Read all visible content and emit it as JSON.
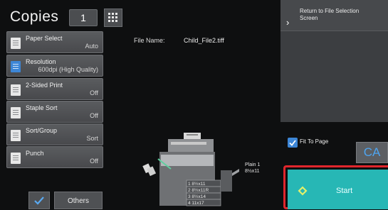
{
  "header": {
    "copies_label": "Copies",
    "copies_count": "1"
  },
  "settings": [
    {
      "title": "Paper Select",
      "value": "Auto",
      "icon": "paper-icon"
    },
    {
      "title": "Resolution",
      "value": "600dpi (High Quality)",
      "icon": "resolution-icon"
    },
    {
      "title": "2-Sided Print",
      "value": "Off",
      "icon": "two-sided-icon"
    },
    {
      "title": "Staple Sort",
      "value": "Off",
      "icon": "staple-icon"
    },
    {
      "title": "Sort/Group",
      "value": "Sort",
      "icon": "sort-group-icon"
    },
    {
      "title": "Punch",
      "value": "Off",
      "icon": "punch-icon"
    }
  ],
  "bottom": {
    "others_label": "Others"
  },
  "file": {
    "label": "File Name:",
    "value": "Child_File2.tiff"
  },
  "right": {
    "return_label": "Return to File Selection Screen",
    "fit_label": "Fit To Page",
    "fit_checked": true,
    "ca_label": "CA",
    "start_label": "Start"
  },
  "machine": {
    "paper_line1": "Plain 1",
    "paper_line2": "8½x11",
    "trays": [
      "1  8½x11",
      "2  8½x11R",
      "3  8½x14",
      "4  11x17"
    ]
  },
  "colors": {
    "start": "#27b7b5",
    "start_outline": "#e0262c",
    "accent": "#3d86d6"
  }
}
